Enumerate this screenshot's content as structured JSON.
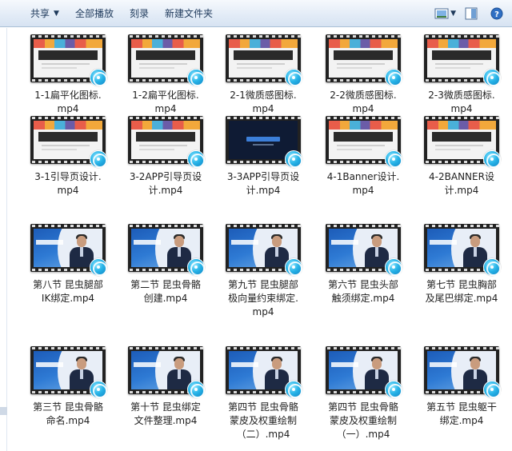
{
  "toolbar": {
    "share_label": "共享",
    "play_all_label": "全部播放",
    "burn_label": "刻录",
    "new_folder_label": "新建文件夹"
  },
  "icons": {
    "view": "view-options-icon",
    "preview": "preview-pane-icon",
    "help": "help-icon",
    "badge": "media-player-badge-icon"
  },
  "colors": {
    "toolbar_top": "#f6f9fd",
    "toolbar_bottom": "#d7e3f2",
    "toolbar_text": "#1e395b",
    "badge": "#27b4e8",
    "rig_blue": "#1d5cb8"
  },
  "files": [
    {
      "name": "1-1扁平化图标.\nmp4",
      "thumb": "ui"
    },
    {
      "name": "1-2扁平化图标.\nmp4",
      "thumb": "ui"
    },
    {
      "name": "2-1微质感图标.\nmp4",
      "thumb": "ui"
    },
    {
      "name": "2-2微质感图标.\nmp4",
      "thumb": "ui"
    },
    {
      "name": "2-3微质感图标.\nmp4",
      "thumb": "ui"
    },
    {
      "name": "3-1引导页设计.\nmp4",
      "thumb": "ui"
    },
    {
      "name": "3-2APP引导页设\n计.mp4",
      "thumb": "ui"
    },
    {
      "name": "3-3APP引导页设\n计.mp4",
      "thumb": "dark"
    },
    {
      "name": "4-1Banner设计.\nmp4",
      "thumb": "ui"
    },
    {
      "name": "4-2BANNER设\n计.mp4",
      "thumb": "ui"
    },
    {
      "name": "第八节 昆虫腿部\nIK绑定.mp4",
      "thumb": "rig"
    },
    {
      "name": "第二节 昆虫骨骼\n创建.mp4",
      "thumb": "rig"
    },
    {
      "name": "第九节 昆虫腿部\n极向量约束绑定.\nmp4",
      "thumb": "rig"
    },
    {
      "name": "第六节 昆虫头部\n触须绑定.mp4",
      "thumb": "rig"
    },
    {
      "name": "第七节 昆虫胸部\n及尾巴绑定.mp4",
      "thumb": "rig"
    },
    {
      "name": "第三节 昆虫骨骼\n命名.mp4",
      "thumb": "rig"
    },
    {
      "name": "第十节 昆虫绑定\n文件整理.mp4",
      "thumb": "rig"
    },
    {
      "name": "第四节 昆虫骨骼\n蒙皮及权重绘制\n（二）.mp4",
      "thumb": "rig"
    },
    {
      "name": "第四节 昆虫骨骼\n蒙皮及权重绘制\n（一）.mp4",
      "thumb": "rig"
    },
    {
      "name": "第五节 昆虫躯干\n绑定.mp4",
      "thumb": "rig"
    }
  ]
}
